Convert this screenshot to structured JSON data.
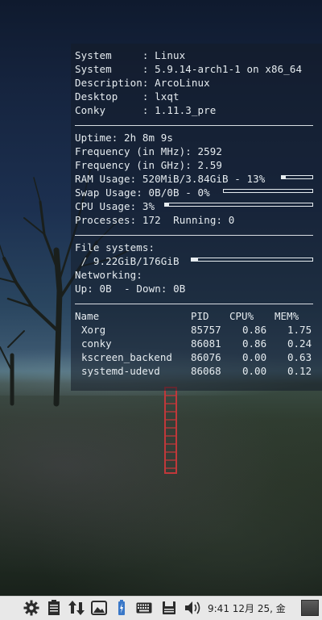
{
  "conky": {
    "system1_label": "System     :",
    "system1_value": "Linux",
    "system2_label": "System     :",
    "system2_value": "5.9.14-arch1-1 on x86_64",
    "description_label": "Description:",
    "description_value": "ArcoLinux",
    "desktop_label": "Desktop    :",
    "desktop_value": "lxqt",
    "conky_label": "Conky      :",
    "conky_value": "1.11.3_pre",
    "uptime_label": "Uptime:",
    "uptime_value": "2h 8m 9s",
    "freq_mhz_label": "Frequency (in MHz):",
    "freq_mhz_value": "2592",
    "freq_ghz_label": "Frequency (in GHz):",
    "freq_ghz_value": "2.59",
    "ram_label": "RAM Usage:",
    "ram_value": "520MiB/3.84GiB - 13%",
    "ram_fraction": 0.13,
    "swap_label": "Swap Usage:",
    "swap_value": "0B/0B - 0%",
    "swap_fraction": 0.0,
    "cpu_label": "CPU Usage:",
    "cpu_value": "3%",
    "cpu_fraction": 0.03,
    "processes_label": "Processes:",
    "processes_value": "172",
    "running_label": "Running:",
    "running_value": "0",
    "filesystems_label": "File systems:",
    "fs_value": " / 9.22GiB/176GiB",
    "fs_fraction": 0.05,
    "networking_label": "Networking:",
    "up_label": "Up:",
    "up_value": "0B",
    "down_label": "- Down:",
    "down_value": "0B",
    "process_table": {
      "headers": [
        "Name",
        "PID",
        "CPU%",
        "MEM%"
      ],
      "rows": [
        {
          "name": "Xorg",
          "pid": "85757",
          "cpu": "0.86",
          "mem": "1.75"
        },
        {
          "name": "conky",
          "pid": "86081",
          "cpu": "0.86",
          "mem": "0.24"
        },
        {
          "name": "kscreen_backend",
          "pid": "86076",
          "cpu": "0.00",
          "mem": "0.63"
        },
        {
          "name": "systemd-udevd",
          "pid": "86068",
          "cpu": "0.00",
          "mem": "0.12"
        }
      ]
    }
  },
  "taskbar": {
    "icons": [
      "settings-gear-icon",
      "clipboard-icon",
      "network-transfer-icon",
      "screenshot-icon",
      "battery-icon",
      "keyboard-icon",
      "removable-drive-icon",
      "volume-icon",
      "show-desktop-icon"
    ],
    "clock": "9:41 12月 25, 金"
  },
  "colors": {
    "conky_text": "#e6ecf0",
    "taskbar_bg": "#e8e8e8",
    "stake": "#c0383a"
  }
}
